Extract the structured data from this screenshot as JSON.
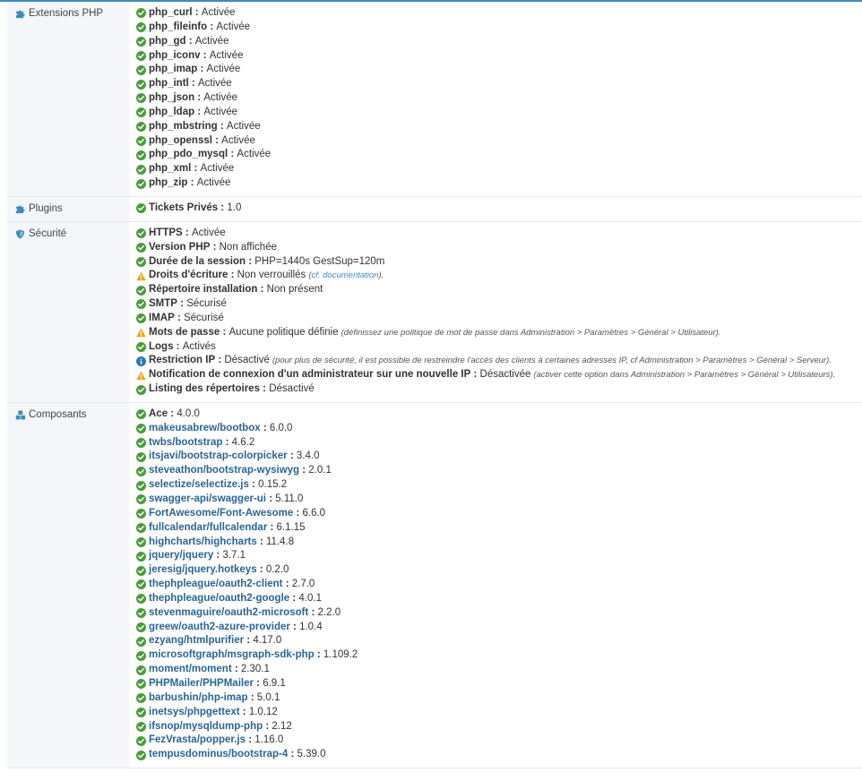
{
  "sections": [
    {
      "id": "php-extensions",
      "label": "Extensions PHP",
      "icon": "puzzle-icon",
      "items": [
        {
          "status": "ok",
          "key": "php_curl",
          "value": "Activée"
        },
        {
          "status": "ok",
          "key": "php_fileinfo",
          "value": "Activée"
        },
        {
          "status": "ok",
          "key": "php_gd",
          "value": "Activée"
        },
        {
          "status": "ok",
          "key": "php_iconv",
          "value": "Activée"
        },
        {
          "status": "ok",
          "key": "php_imap",
          "value": "Activée"
        },
        {
          "status": "ok",
          "key": "php_intl",
          "value": "Activée"
        },
        {
          "status": "ok",
          "key": "php_json",
          "value": "Activée"
        },
        {
          "status": "ok",
          "key": "php_ldap",
          "value": "Activée"
        },
        {
          "status": "ok",
          "key": "php_mbstring",
          "value": "Activée"
        },
        {
          "status": "ok",
          "key": "php_openssl",
          "value": "Activée"
        },
        {
          "status": "ok",
          "key": "php_pdo_mysql",
          "value": "Activée"
        },
        {
          "status": "ok",
          "key": "php_xml",
          "value": "Activée"
        },
        {
          "status": "ok",
          "key": "php_zip",
          "value": "Activée"
        }
      ]
    },
    {
      "id": "plugins",
      "label": "Plugins",
      "icon": "puzzle-icon",
      "items": [
        {
          "status": "ok",
          "key": "Tickets Privés",
          "value": "1.0"
        }
      ]
    },
    {
      "id": "security",
      "label": "Sécurité",
      "icon": "shield-icon",
      "items": [
        {
          "status": "ok",
          "key": "HTTPS",
          "value": "Activée"
        },
        {
          "status": "ok",
          "key": "Version PHP",
          "value": "Non affichée"
        },
        {
          "status": "ok",
          "key": "Durée de la session",
          "value": "PHP=1440s GestSup=120m"
        },
        {
          "status": "warn",
          "key": "Droits d'écriture",
          "value": "Non verrouillés",
          "note_pre": "(",
          "note_link": "cf. documentation",
          "note_post": ")."
        },
        {
          "status": "ok",
          "key": "Répertoire installation",
          "value": "Non présent"
        },
        {
          "status": "ok",
          "key": "SMTP",
          "value": "Sécurisé"
        },
        {
          "status": "ok",
          "key": "IMAP",
          "value": "Sécurisé"
        },
        {
          "status": "warn",
          "key": "Mots de passe",
          "value": "Aucune politique définie",
          "note": "(définissez une politique de mot de passe dans Administration > Paramètres > Général > Utilisateur)."
        },
        {
          "status": "ok",
          "key": "Logs",
          "value": "Activés"
        },
        {
          "status": "info",
          "key": "Restriction IP",
          "value": "Désactivé",
          "note": "(pour plus de sécurité, il est possible de restreindre l'accès des clients à certaines adresses IP, cf Administration > Paramètres > Général > Serveur)."
        },
        {
          "status": "warn",
          "key": "Notification de connexion d'un administrateur sur une nouvelle IP",
          "value": "Désactivée",
          "note": "(activer cette option dans Administration > Paramètres > Général > Utilisateurs)."
        },
        {
          "status": "ok",
          "key": "Listing des répertoires",
          "value": "Désactivé"
        }
      ]
    },
    {
      "id": "components",
      "label": "Composants",
      "icon": "cubes-icon",
      "items": [
        {
          "status": "ok",
          "key": "Ace",
          "value": "4.0.0"
        },
        {
          "status": "ok",
          "key": "makeusabrew/bootbox",
          "value": "6.0.0",
          "link": true
        },
        {
          "status": "ok",
          "key": "twbs/bootstrap",
          "value": "4.6.2",
          "link": true
        },
        {
          "status": "ok",
          "key": "itsjavi/bootstrap-colorpicker",
          "value": "3.4.0",
          "link": true
        },
        {
          "status": "ok",
          "key": "steveathon/bootstrap-wysiwyg",
          "value": "2.0.1",
          "link": true
        },
        {
          "status": "ok",
          "key": "selectize/selectize.js",
          "value": "0.15.2",
          "link": true
        },
        {
          "status": "ok",
          "key": "swagger-api/swagger-ui",
          "value": "5.11.0",
          "link": true
        },
        {
          "status": "ok",
          "key": "FortAwesome/Font-Awesome",
          "value": "6.6.0",
          "link": true
        },
        {
          "status": "ok",
          "key": "fullcalendar/fullcalendar",
          "value": "6.1.15",
          "link": true
        },
        {
          "status": "ok",
          "key": "highcharts/highcharts",
          "value": "11.4.8",
          "link": true
        },
        {
          "status": "ok",
          "key": "jquery/jquery",
          "value": "3.7.1",
          "link": true
        },
        {
          "status": "ok",
          "key": "jeresig/jquery.hotkeys",
          "value": "0.2.0",
          "link": true
        },
        {
          "status": "ok",
          "key": "thephpleague/oauth2-client",
          "value": "2.7.0",
          "link": true
        },
        {
          "status": "ok",
          "key": "thephpleague/oauth2-google",
          "value": "4.0.1",
          "link": true
        },
        {
          "status": "ok",
          "key": "stevenmaguire/oauth2-microsoft",
          "value": "2.2.0",
          "link": true
        },
        {
          "status": "ok",
          "key": "greew/oauth2-azure-provider",
          "value": "1.0.4",
          "link": true
        },
        {
          "status": "ok",
          "key": "ezyang/htmlpurifier",
          "value": "4.17.0",
          "link": true
        },
        {
          "status": "ok",
          "key": "microsoftgraph/msgraph-sdk-php",
          "value": "1.109.2",
          "link": true
        },
        {
          "status": "ok",
          "key": "moment/moment",
          "value": "2.30.1",
          "link": true
        },
        {
          "status": "ok",
          "key": "PHPMailer/PHPMailer",
          "value": "6.9.1",
          "link": true
        },
        {
          "status": "ok",
          "key": "barbushin/php-imap",
          "value": "5.0.1",
          "link": true
        },
        {
          "status": "ok",
          "key": "inetsys/phpgettext",
          "value": "1.0.12",
          "link": true
        },
        {
          "status": "ok",
          "key": "ifsnop/mysqldump-php",
          "value": "2.12",
          "link": true
        },
        {
          "status": "ok",
          "key": "FezVrasta/popper.js",
          "value": "1.16.0",
          "link": true
        },
        {
          "status": "ok",
          "key": "tempusdominus/bootstrap-4",
          "value": "5.39.0",
          "link": true
        }
      ]
    }
  ],
  "colors": {
    "ok": "#4a9d3b",
    "warn": "#f0a30a",
    "info": "#2f79b5",
    "link": "#2a6496",
    "label_icon": "#3c8dbc",
    "label_bg": "#f4f6f9"
  }
}
